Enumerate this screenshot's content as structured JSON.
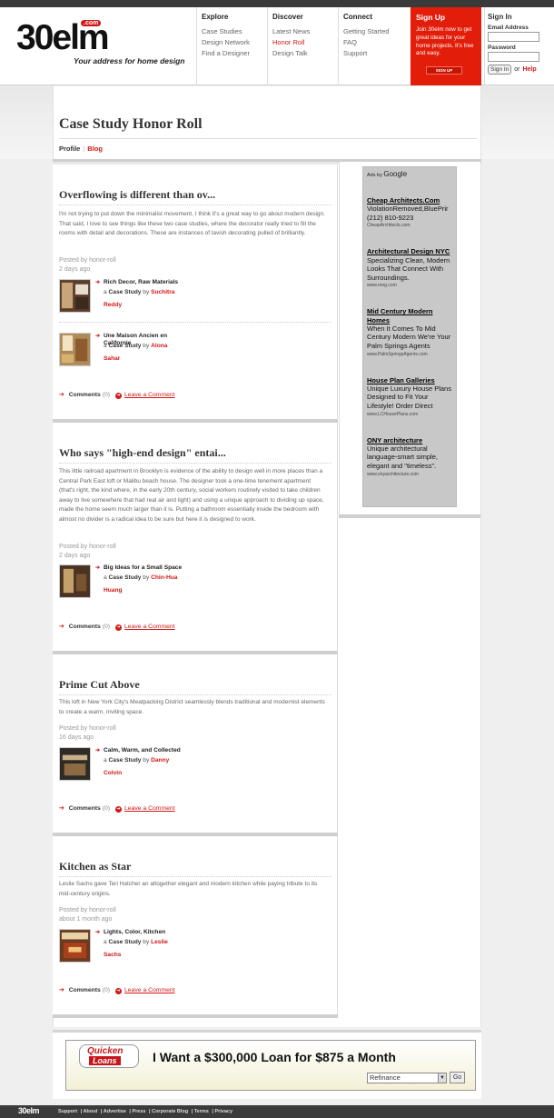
{
  "brand": {
    "logo_text": "30elm",
    "logo_badge": ".com",
    "tagline": "Your address for home design"
  },
  "nav": [
    {
      "title": "Explore",
      "links": [
        "Case Studies",
        "Design Network",
        "Find a Designer"
      ]
    },
    {
      "title": "Discover",
      "links": [
        "Latest News",
        "Honor Roll",
        "Design Talk"
      ]
    },
    {
      "title": "Connect",
      "links": [
        "Getting Started",
        "FAQ",
        "Support"
      ]
    }
  ],
  "signup": {
    "title": "Sign Up",
    "text": "Join 30elm now to get great ideas for your home projects. It's free and easy.",
    "button": "SIGN UP"
  },
  "signin": {
    "title": "Sign In",
    "email_label": "Email Address",
    "password_label": "Password",
    "button": "Sign In",
    "or": "or",
    "help": "Help"
  },
  "page": {
    "title": "Case Study Honor Roll",
    "tabs": [
      "Profile",
      "Blog"
    ]
  },
  "posts": [
    {
      "title": "Overflowing is different than ov...",
      "body": "I'm not trying to put down the minimalist movement, I think it's a great way to go about modern design. That said, I love to see things like these two case studies, where the decorator really tried to fill the rooms with detail and decorations. These are instances of lavish decorating pulled of brilliantly.",
      "posted_by": "Posted by honor-roll",
      "when": "2 days ago",
      "items": [
        {
          "title": "Rich Decor, Raw Materials",
          "a": "a",
          "cs": "Case Study",
          "by": "by",
          "author1": "Suchitra",
          "author2": "Reddy"
        },
        {
          "title": "Une Maison Ancien en Californie",
          "a": "a",
          "cs": "Case Study",
          "by": "by",
          "author1": "Alona",
          "author2": "Sahar"
        }
      ],
      "comments_label": "Comments",
      "comments_count": "(0)",
      "leave": "Leave a Comment"
    },
    {
      "title": "Who says \"high-end design\" entai...",
      "body": "This little railroad apartment in Brooklyn is evidence of the ability to design well in more places than a Central Park East loft or Malibu beach house. The designer took a one-time tenement apartment (that's right, the kind where, in the early 20th century, social workers routinely visited to take children away to live somewhere that had real air and light) and using a unique approach to dividing up space, made the home seem much larger than it is. Putting a bathroom essentially inside the bedroom with almost no divider is a radical idea to be sure but here it is designed to work.",
      "posted_by": "Posted by honor-roll",
      "when": "2 days ago",
      "items": [
        {
          "title": "Big Ideas for a Small Space",
          "a": "a",
          "cs": "Case Study",
          "by": "by",
          "author1": "Chin-Hua",
          "author2": "Huang"
        }
      ],
      "comments_label": "Comments",
      "comments_count": "(0)",
      "leave": "Leave a Comment"
    },
    {
      "title": "Prime Cut Above",
      "body": "This loft in New York City's Meatpacking District seamlessly blends traditional and modernist elements to create a warm, inviting space.",
      "posted_by": "Posted by honor-roll",
      "when": "16 days ago",
      "items": [
        {
          "title": "Calm, Warm, and Collected",
          "a": "a",
          "cs": "Case Study",
          "by": "by",
          "author1": "Danny",
          "author2": "Colvin"
        }
      ],
      "comments_label": "Comments",
      "comments_count": "(0)",
      "leave": "Leave a Comment"
    },
    {
      "title": "Kitchen as Star",
      "body": "Leslie Sachs gave Teri Hatcher an altogether elegant and modern kitchen while paying tribute to its mid-century origins.",
      "posted_by": "Posted by honor-roll",
      "when": "about 1 month ago",
      "items": [
        {
          "title": "Lights, Color, Kitchen",
          "a": "a",
          "cs": "Case Study",
          "by": "by",
          "author1": "Leslie",
          "author2": "Sachs"
        }
      ],
      "comments_label": "Comments",
      "comments_count": "(0)",
      "leave": "Leave a Comment"
    }
  ],
  "ads": {
    "label": "Ads by",
    "brand": "Google",
    "items": [
      {
        "head": "Cheap Architects.Com",
        "text": "ViolationRemoved,BluePrir (212) 810-9223",
        "url": "CheapArchitects.com"
      },
      {
        "head": "Architectural Design NYC",
        "text": "Specializing Clean, Modern Looks That Connect With Surroundings.",
        "url": "www.reng.com"
      },
      {
        "head": "Mid Century Modern Homes",
        "text": "When It Comes To Mid Century Modern We're Your Palm Springs Agents",
        "url": "www.PalmSpringsAgents.com"
      },
      {
        "head": "House Plan Galleries",
        "text": "Unique Luxury House Plans Designed to Fit Your Lifestyle! Order Direct",
        "url": "www.LCHousePlans.com"
      },
      {
        "head": "ONY architecture",
        "text": "Unique architectural language-smart simple, elegant and \"timeless\".",
        "url": "www.onyarchitecture.com"
      }
    ]
  },
  "banner": {
    "logo_top": "Quicken",
    "logo_bottom": "Loans",
    "headline": "I Want a $300,000 Loan for $875 a Month",
    "select_value": "Refinance",
    "go": "Go"
  },
  "footer": {
    "logo": "30elm",
    "links": [
      "Support",
      "About",
      "Advertise",
      "Press",
      "Corporate Blog",
      "Terms",
      "Privacy"
    ]
  },
  "colors": {
    "accent": "#d21818",
    "signup_bg": "#e21d0a",
    "ads_bg": "#c8c8c8"
  }
}
